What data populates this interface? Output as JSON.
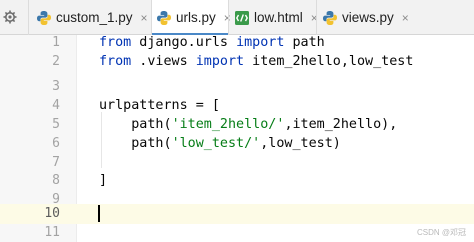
{
  "tabs": [
    {
      "label": "custom_1.py",
      "icon": "python-file-icon",
      "close": "×"
    },
    {
      "label": "urls.py",
      "icon": "python-file-icon",
      "close": "×",
      "active": true
    },
    {
      "label": "low.html",
      "icon": "html-file-icon",
      "close": "×"
    },
    {
      "label": "views.py",
      "icon": "python-file-icon",
      "close": "×"
    }
  ],
  "gutter": {
    "line_numbers": [
      "1",
      "2",
      "3",
      "4",
      "5",
      "6",
      "7",
      "8",
      "9",
      "10",
      "11"
    ],
    "current_line": "10"
  },
  "code": {
    "line1": {
      "kw1": "from",
      "mod": " django.urls ",
      "kw2": "import",
      "rest": " path"
    },
    "line2": {
      "kw1": "from",
      "mod": " .views ",
      "kw2": "import",
      "rest": " item_2hello,low_test"
    },
    "line4": {
      "text": "urlpatterns = ["
    },
    "line5": {
      "pre": "    path(",
      "str": "'item_2hello/'",
      "post": ",item_2hello),"
    },
    "line6": {
      "pre": "    path(",
      "str": "'low_test/'",
      "post": ",low_test)"
    },
    "line8": {
      "text": "]"
    }
  },
  "watermark": "CSDN @邓冠",
  "colors": {
    "keyword": "#0033b3",
    "string": "#067d17",
    "active_tab_underline": "#4a88c7",
    "current_line_highlight": "#fdfbe6"
  }
}
